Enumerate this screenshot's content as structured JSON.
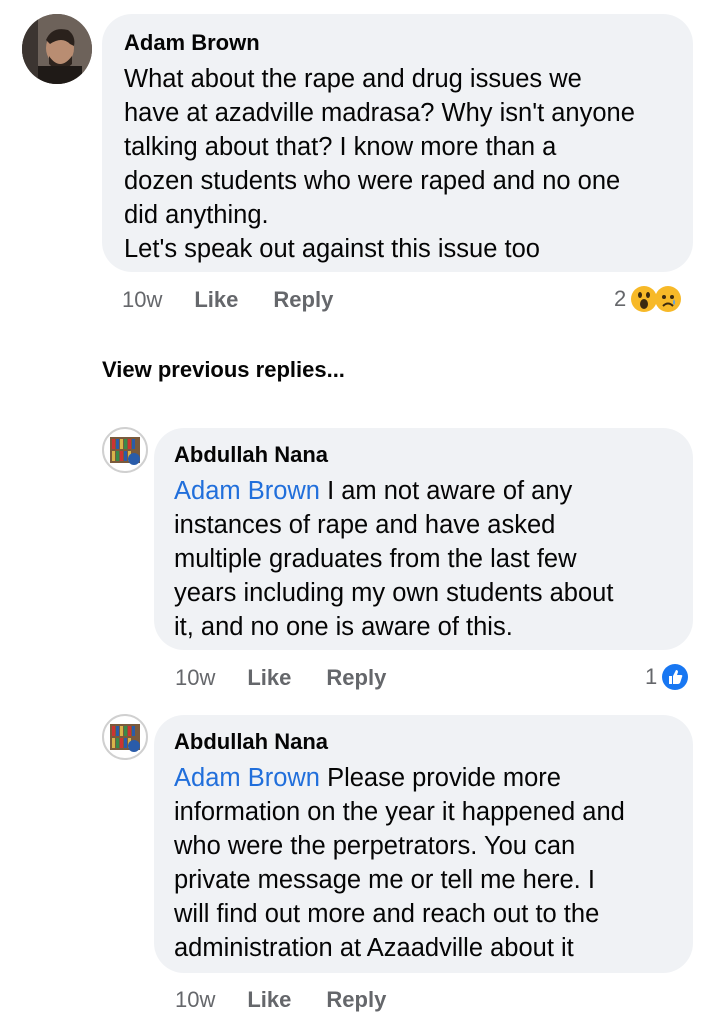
{
  "comment": {
    "author": "Adam Brown",
    "text": "What about the rape and drug issues we\nhave at azadville madrasa? Why isn't anyone\ntalking about that? I know more than a\ndozen students who were raped and no one\ndid anything.\nLet's speak out against this issue too",
    "time": "10w",
    "like_label": "Like",
    "reply_label": "Reply",
    "reaction_count": "2",
    "reaction_icons": [
      "wow-emoji-icon",
      "sad-emoji-icon"
    ]
  },
  "view_previous_label": "View previous replies...",
  "replies": [
    {
      "author": "Abdullah Nana",
      "mention": "Adam Brown",
      "text": " I am not aware of any\ninstances of rape and have asked\nmultiple graduates from the last few\nyears including my own students about\nit, and no one is aware of this.",
      "time": "10w",
      "like_label": "Like",
      "reply_label": "Reply",
      "reaction_count": "1",
      "reaction_icons": [
        "like-reaction-icon"
      ]
    },
    {
      "author": "Abdullah Nana",
      "mention": "Adam Brown",
      "text": " Please provide more\ninformation on the year it happened and\nwho were the perpetrators. You can\nprivate message me or tell me here. I\nwill find out more and reach out to the\nadministration at Azaadville about it",
      "time": "10w",
      "like_label": "Like",
      "reply_label": "Reply"
    }
  ],
  "colors": {
    "bubble_bg": "#f0f2f5",
    "mention": "#216fdb",
    "meta_text": "#65676b",
    "like_blue": "#1877f2",
    "emoji_yellow": "#f7b928"
  }
}
